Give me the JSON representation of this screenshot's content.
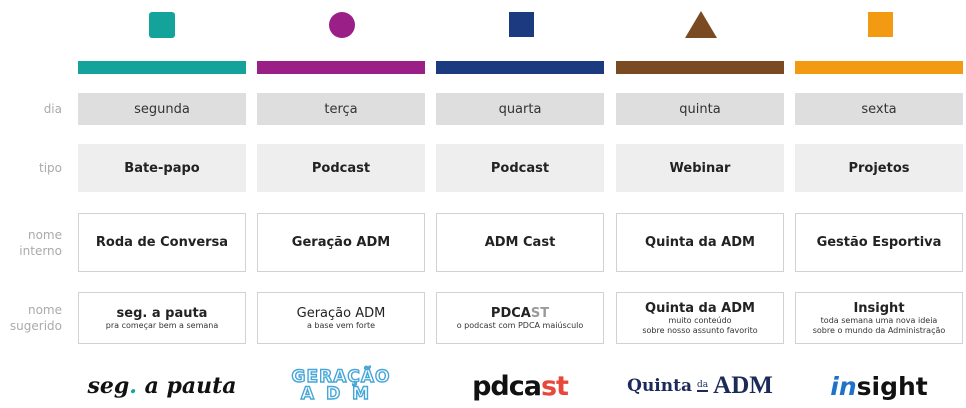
{
  "row_labels": {
    "dia": "dia",
    "tipo": "tipo",
    "nome_interno_1": "nome",
    "nome_interno_2": "interno",
    "nome_sugerido_1": "nome",
    "nome_sugerido_2": "sugerido"
  },
  "colors": {
    "teal": "#13a39a",
    "purple": "#9a1f86",
    "navy": "#1c3a80",
    "brown": "#7a4a22",
    "orange": "#f39a13",
    "day_bg": "#dedede",
    "tipo_bg": "#eeeeee"
  },
  "columns": [
    {
      "shape": "square-rounded",
      "day": "segunda",
      "type": "Bate-papo",
      "internal_name": "Roda de Conversa",
      "suggested_title": "seg. a pauta",
      "suggested_sub": "pra começar bem a semana",
      "logo": {
        "a": "seg",
        "b": ".",
        "c": " a pauta"
      }
    },
    {
      "shape": "circle",
      "day": "terça",
      "type": "Podcast",
      "internal_name": "Geração ADM",
      "suggested_title": "Geração ADM",
      "suggested_sub": "a base vem forte",
      "logo": {
        "a": "GERAÇÃO",
        "b": "ADM"
      }
    },
    {
      "shape": "square",
      "day": "quarta",
      "type": "Podcast",
      "internal_name": "ADM Cast",
      "suggested_title_a": "PDCA",
      "suggested_title_b": "ST",
      "suggested_sub": "o podcast com PDCA maiúsculo",
      "logo": {
        "a": "pdca",
        "b": "st"
      }
    },
    {
      "shape": "triangle",
      "day": "quinta",
      "type": "Webinar",
      "internal_name": "Quinta da ADM",
      "suggested_title": "Quinta da ADM",
      "suggested_sub1": "muito conteúdo",
      "suggested_sub2": "sobre nosso assunto favorito",
      "logo": {
        "a": "Quinta",
        "b": "da",
        "c": "ADM"
      }
    },
    {
      "shape": "square",
      "day": "sexta",
      "type": "Projetos",
      "internal_name": "Gestão Esportiva",
      "suggested_title": "Insight",
      "suggested_sub1": "toda semana uma nova ideia",
      "suggested_sub2": "sobre o mundo da Administração",
      "logo": {
        "a": "in",
        "b": "sight"
      }
    }
  ]
}
